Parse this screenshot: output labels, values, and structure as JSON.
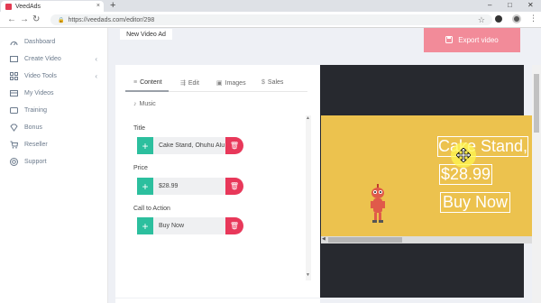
{
  "browser": {
    "tab_title": "VeedAds",
    "tab_close": "×",
    "new_tab": "+",
    "url": "https://veedads.com/editor/298",
    "win_min": "–",
    "win_max": "□",
    "win_close": "✕"
  },
  "sidebar": {
    "items": [
      {
        "label": "Dashboard",
        "icon": "dashboard-icon"
      },
      {
        "label": "Create Video",
        "icon": "create-video-icon",
        "chevron": "‹"
      },
      {
        "label": "Video Tools",
        "icon": "video-tools-icon",
        "chevron": "‹"
      },
      {
        "label": "My Videos",
        "icon": "my-videos-icon"
      },
      {
        "label": "Training",
        "icon": "training-icon"
      },
      {
        "label": "Bonus",
        "icon": "bonus-icon"
      },
      {
        "label": "Reseller",
        "icon": "reseller-icon"
      },
      {
        "label": "Support",
        "icon": "support-icon"
      }
    ]
  },
  "header": {
    "ad_name": "New Video Ad",
    "export_label": "Export video"
  },
  "editor": {
    "tabs": [
      {
        "label": "Content",
        "icon": "content-icon"
      },
      {
        "label": "Edit",
        "icon": "edit-icon"
      },
      {
        "label": "Images",
        "icon": "images-icon"
      },
      {
        "label": "Sales",
        "icon": "dollar-icon"
      },
      {
        "label": "Music",
        "icon": "music-icon"
      }
    ],
    "fields": [
      {
        "label": "Title",
        "value": "Cake Stand, Ohuhu Alu"
      },
      {
        "label": "Price",
        "value": "$28.99"
      },
      {
        "label": "Call to Action",
        "value": "Buy Now"
      }
    ]
  },
  "preview": {
    "title_text": "Cake Stand,",
    "price_text": "$28.99",
    "cta_text": "Buy Now",
    "background_color": "#ecc24e"
  },
  "colors": {
    "accent_green": "#2cbf9e",
    "accent_red": "#e8385a",
    "export_pink": "#f28b99"
  }
}
